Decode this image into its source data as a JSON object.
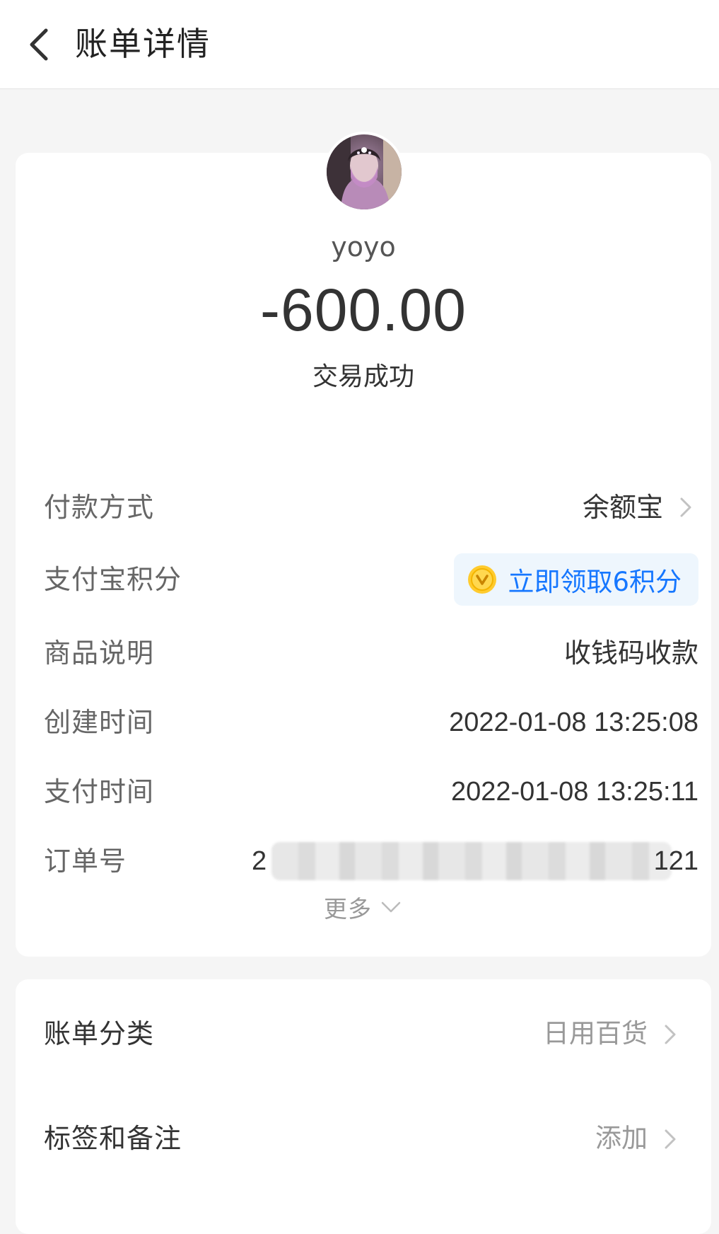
{
  "header": {
    "title": "账单详情"
  },
  "transaction": {
    "counterparty": "yoyo",
    "amount": "-600.00",
    "status": "交易成功"
  },
  "details": {
    "payment_method": {
      "label": "付款方式",
      "value": "余额宝"
    },
    "points": {
      "label": "支付宝积分",
      "value": "立即领取6积分"
    },
    "description": {
      "label": "商品说明",
      "value": "收钱码收款"
    },
    "created_time": {
      "label": "创建时间",
      "value": "2022-01-08 13:25:08"
    },
    "paid_time": {
      "label": "支付时间",
      "value": "2022-01-08 13:25:11"
    },
    "order_number": {
      "label": "订单号",
      "prefix": "2",
      "suffix": "121"
    },
    "more": "更多"
  },
  "classification": {
    "category": {
      "label": "账单分类",
      "value": "日用百货"
    },
    "tags": {
      "label": "标签和备注",
      "value": "添加"
    }
  },
  "colors": {
    "accent_blue": "#1677ff",
    "points_bg": "#eef6fd",
    "page_bg": "#f5f5f5"
  },
  "icons": {
    "back": "chevron-left-icon",
    "row_arrow": "chevron-right-icon",
    "more": "chevron-down-icon",
    "points": "points-coin-icon"
  }
}
